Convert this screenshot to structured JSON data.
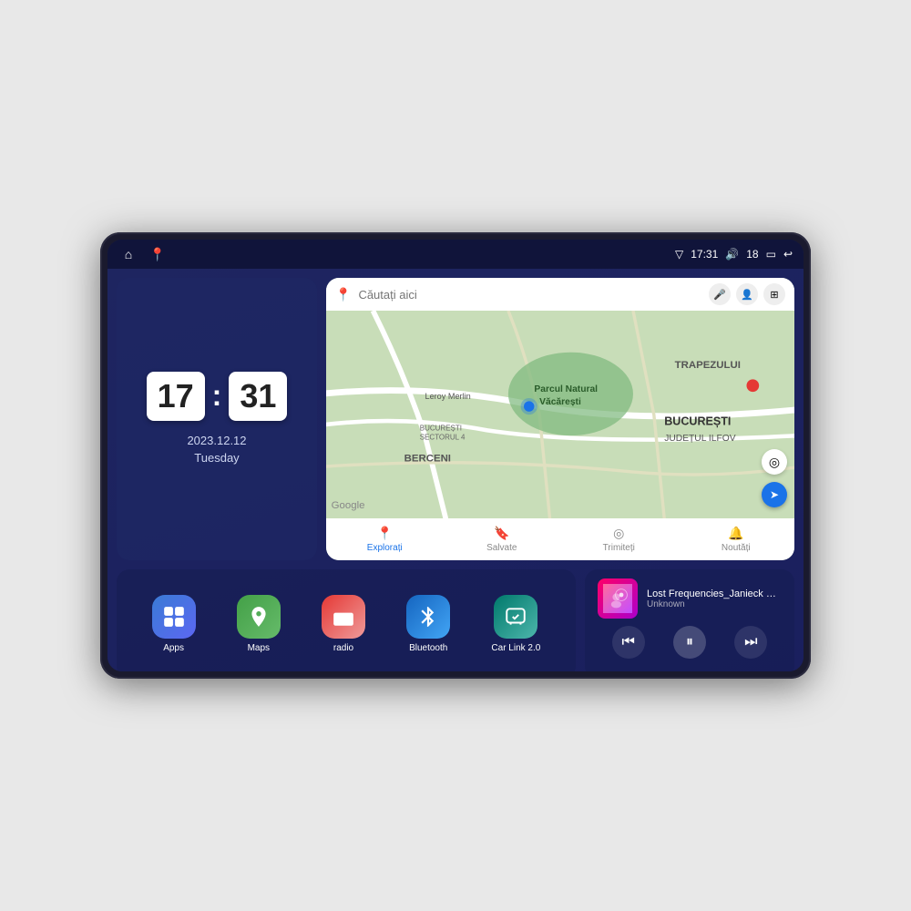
{
  "device": {
    "status_bar": {
      "left_icons": [
        "home",
        "maps"
      ],
      "time": "17:31",
      "signal_icon": "▽",
      "volume_icon": "🔊",
      "battery_val": "18",
      "battery_icon": "🔋",
      "back_icon": "↩"
    },
    "clock": {
      "hours": "17",
      "minutes": "31",
      "date": "2023.12.12",
      "day": "Tuesday"
    },
    "map": {
      "search_placeholder": "Căutați aici",
      "mic_icon": "🎤",
      "profile_icon": "👤",
      "layers_icon": "⊞",
      "labels": [
        "TRAPEZULUI",
        "BUCUREȘTI",
        "JUDEȚUL ILFOV",
        "BERCENI"
      ],
      "location_labels": [
        "Parcul Natural Văcărești",
        "Leroy Merlin",
        "BUCUREȘTI SECTORUL 4"
      ],
      "nav_items": [
        {
          "label": "Explorați",
          "icon": "📍",
          "active": true
        },
        {
          "label": "Salvate",
          "icon": "🔖",
          "active": false
        },
        {
          "label": "Trimiteți",
          "icon": "◎",
          "active": false
        },
        {
          "label": "Noutăți",
          "icon": "🔔",
          "active": false
        }
      ]
    },
    "apps": [
      {
        "id": "apps",
        "label": "Apps",
        "icon": "⊞",
        "color_class": "icon-apps"
      },
      {
        "id": "maps",
        "label": "Maps",
        "icon": "📍",
        "color_class": "icon-maps"
      },
      {
        "id": "radio",
        "label": "radio",
        "icon": "📻",
        "color_class": "icon-radio"
      },
      {
        "id": "bluetooth",
        "label": "Bluetooth",
        "icon": "₿",
        "color_class": "icon-bt"
      },
      {
        "id": "carlink",
        "label": "Car Link 2.0",
        "icon": "📱",
        "color_class": "icon-carlink"
      }
    ],
    "music": {
      "title": "Lost Frequencies_Janieck Devy-...",
      "artist": "Unknown",
      "prev_icon": "⏮",
      "play_icon": "⏸",
      "next_icon": "⏭"
    }
  }
}
